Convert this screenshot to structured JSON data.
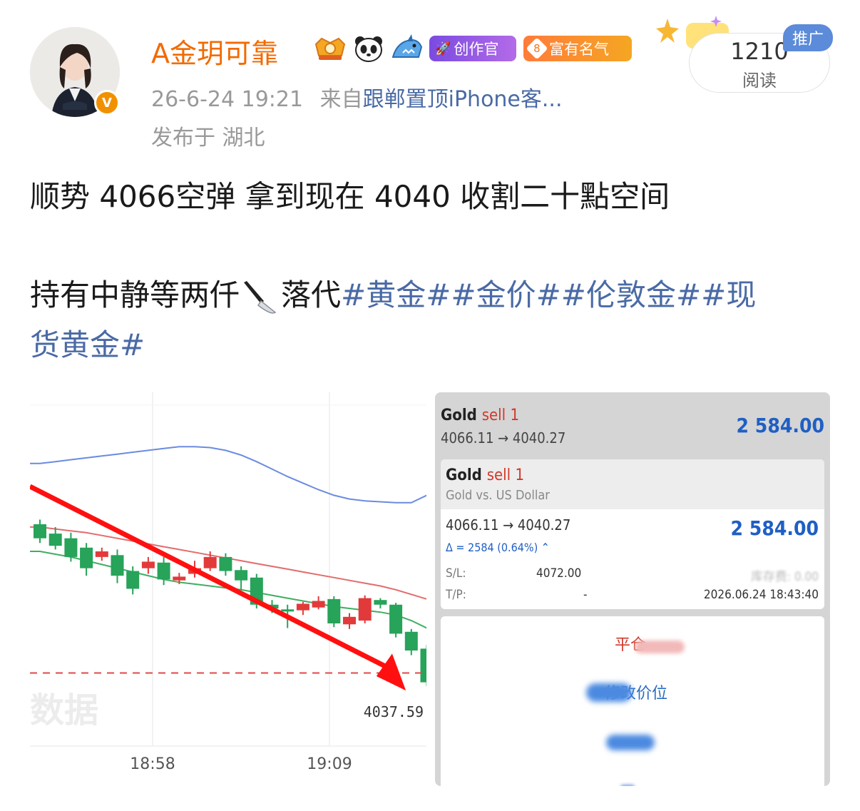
{
  "user": {
    "name": "A金玥可靠",
    "timestamp": "26-6-24 19:21",
    "from_label": "来自",
    "source": "跟郸置顶iPhone客...",
    "location": "发布于 湖北",
    "tags": {
      "creator": "创作官",
      "level": "8",
      "fame": "富有名气"
    }
  },
  "read": {
    "count": "1210",
    "label": "阅读",
    "promo": "推广"
  },
  "post": {
    "line1": "顺势 4066空弹  拿到现在 4040  收割二十點空间",
    "line2_prefix": "持有中静等两仟",
    "line2_suffix": "落代",
    "hashtags_line2": "#黄金##金价##伦敦金##现",
    "hashtags_line3": "货黄金#"
  },
  "chart_data": {
    "type": "candlestick",
    "x_ticks": [
      "18:58",
      "19:09"
    ],
    "price_label": "4037.59",
    "watermark": "数据",
    "candles": [
      {
        "o": 4046.5,
        "c": 4045.0,
        "h": 4047.0,
        "l": 4044.5
      },
      {
        "o": 4045.5,
        "c": 4044.2,
        "h": 4046.2,
        "l": 4043.8
      },
      {
        "o": 4045.0,
        "c": 4043.0,
        "h": 4045.6,
        "l": 4042.5
      },
      {
        "o": 4044.0,
        "c": 4041.8,
        "h": 4044.5,
        "l": 4041.0
      },
      {
        "o": 4043.0,
        "c": 4043.6,
        "h": 4044.0,
        "l": 4042.6
      },
      {
        "o": 4043.2,
        "c": 4041.0,
        "h": 4043.8,
        "l": 4040.2
      },
      {
        "o": 4041.5,
        "c": 4039.6,
        "h": 4042.0,
        "l": 4039.0
      },
      {
        "o": 4041.8,
        "c": 4042.5,
        "h": 4043.0,
        "l": 4041.2
      },
      {
        "o": 4042.4,
        "c": 4040.6,
        "h": 4043.0,
        "l": 4040.0
      },
      {
        "o": 4040.5,
        "c": 4040.9,
        "h": 4041.3,
        "l": 4040.1
      },
      {
        "o": 4041.2,
        "c": 4041.8,
        "h": 4042.6,
        "l": 4040.8
      },
      {
        "o": 4041.8,
        "c": 4043.0,
        "h": 4043.6,
        "l": 4041.5
      },
      {
        "o": 4043.0,
        "c": 4041.5,
        "h": 4043.4,
        "l": 4041.0
      },
      {
        "o": 4041.6,
        "c": 4040.5,
        "h": 4042.0,
        "l": 4039.5
      },
      {
        "o": 4040.8,
        "c": 4037.9,
        "h": 4041.2,
        "l": 4037.5
      },
      {
        "o": 4037.9,
        "c": 4037.5,
        "h": 4038.4,
        "l": 4037.0
      },
      {
        "o": 4037.4,
        "c": 4037.2,
        "h": 4037.9,
        "l": 4035.4
      },
      {
        "o": 4037.3,
        "c": 4038.0,
        "h": 4038.2,
        "l": 4036.8
      },
      {
        "o": 4037.6,
        "c": 4038.3,
        "h": 4038.8,
        "l": 4037.4
      },
      {
        "o": 4038.5,
        "c": 4035.9,
        "h": 4038.8,
        "l": 4035.5
      },
      {
        "o": 4035.8,
        "c": 4036.6,
        "h": 4037.0,
        "l": 4035.3
      },
      {
        "o": 4036.2,
        "c": 4038.6,
        "h": 4038.9,
        "l": 4035.9
      },
      {
        "o": 4038.4,
        "c": 4037.9,
        "h": 4038.6,
        "l": 4037.5
      },
      {
        "o": 4037.9,
        "c": 4034.8,
        "h": 4038.1,
        "l": 4034.4
      },
      {
        "o": 4035.0,
        "c": 4033.0,
        "h": 4035.3,
        "l": 4032.5
      },
      {
        "o": 4033.2,
        "c": 4029.6,
        "h": 4033.6,
        "l": 4029.2
      }
    ],
    "upper_band": [
      4053.0,
      4053.2,
      4053.4,
      4053.6,
      4053.8,
      4054.0,
      4054.2,
      4054.4,
      4054.6,
      4054.8,
      4054.8,
      4054.7,
      4054.4,
      4053.9,
      4053.2,
      4052.4,
      4051.6,
      4050.9,
      4050.2,
      4049.6,
      4049.2,
      4049.0,
      4048.9,
      4048.8,
      4048.8,
      4049.6
    ],
    "middle_band": [
      4046.2,
      4046.0,
      4045.8,
      4045.6,
      4045.3,
      4045.0,
      4044.7,
      4044.4,
      4044.1,
      4043.8,
      4043.5,
      4043.2,
      4042.9,
      4042.6,
      4042.3,
      4042.0,
      4041.7,
      4041.4,
      4041.1,
      4040.8,
      4040.5,
      4040.2,
      4039.9,
      4039.5,
      4039.0,
      4038.5
    ],
    "lower_band": [
      4043.6,
      4043.3,
      4043.0,
      4042.6,
      4042.2,
      4041.8,
      4041.4,
      4041.0,
      4040.6,
      4040.3,
      4040.1,
      4039.9,
      4039.7,
      4039.5,
      4039.2,
      4038.9,
      4038.6,
      4038.3,
      4038.0,
      4037.7,
      4037.5,
      4037.3,
      4037.1,
      4036.8,
      4036.2,
      4035.4
    ],
    "dashed_level": 4030.6,
    "ylim": [
      4024,
      4060
    ]
  },
  "trade": {
    "summary_title": "Gold",
    "summary_side": "sell 1",
    "summary_prices": "4066.11 → 4040.27",
    "summary_profit": "2 584.00",
    "detail_title": "Gold",
    "detail_side": "sell 1",
    "detail_subtitle": "Gold vs. US Dollar",
    "detail_prices": "4066.11 → 4040.27",
    "detail_profit": "2 584.00",
    "delta": "Δ = 2584 (0.64%)",
    "sl_label": "S/L:",
    "sl_value": "4072.00",
    "tp_label": "T/P:",
    "tp_value": "-",
    "swap_label": "库存费:",
    "swap_value": "0.00",
    "open_time": "2026.06.24 18:43:40",
    "action_close": "平仓",
    "action_modify": "修改价位"
  },
  "colors": {
    "username": "#f26a00",
    "link": "#4a6aa5",
    "profit": "#1f5fc4",
    "sell": "#d0392b",
    "up": "#e23a3a",
    "down": "#27a35a"
  }
}
